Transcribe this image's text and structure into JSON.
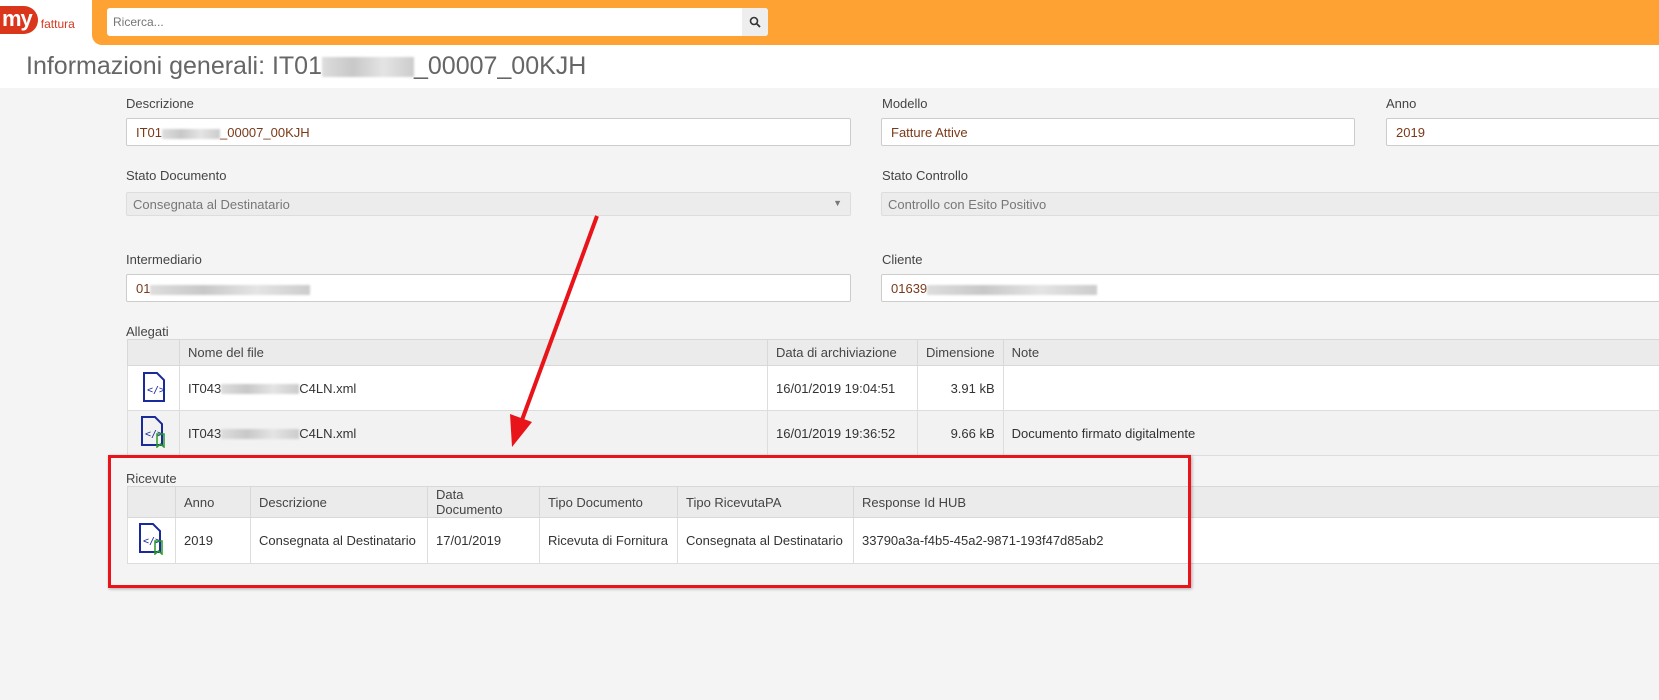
{
  "app": {
    "logo_main": "my",
    "logo_sub": "fattura"
  },
  "search": {
    "placeholder": "Ricerca..."
  },
  "page": {
    "title_prefix": "Informazioni generali: IT01",
    "title_suffix": "_00007_00KJH"
  },
  "form": {
    "descrizione": {
      "label": "Descrizione",
      "prefix": "IT01",
      "suffix": "_00007_00KJH"
    },
    "modello": {
      "label": "Modello",
      "value": "Fatture Attive"
    },
    "anno": {
      "label": "Anno",
      "value": "2019"
    },
    "stato_documento": {
      "label": "Stato Documento",
      "value": "Consegnata al Destinatario"
    },
    "stato_controllo": {
      "label": "Stato Controllo",
      "value": "Controllo con Esito Positivo"
    },
    "intermediario": {
      "label": "Intermediario",
      "prefix": "01"
    },
    "cliente": {
      "label": "Cliente",
      "prefix": "01639"
    }
  },
  "allegati": {
    "label": "Allegati",
    "columns": [
      "",
      "Nome del file",
      "Data di archiviazione",
      "Dimensione",
      "Note"
    ],
    "rows": [
      {
        "icon": "xml-file-icon",
        "name_prefix": "IT043",
        "name_suffix": "C4LN.xml",
        "date": "16/01/2019 19:04:51",
        "size": "3.91 kB",
        "note": ""
      },
      {
        "icon": "signed-xml-file-icon",
        "name_prefix": "IT043",
        "name_suffix": "C4LN.xml",
        "date": "16/01/2019 19:36:52",
        "size": "9.66 kB",
        "note": "Documento firmato digitalmente"
      }
    ]
  },
  "ricevute": {
    "label": "Ricevute",
    "columns": [
      "",
      "Anno",
      "Descrizione",
      "Data Documento",
      "Tipo Documento",
      "Tipo RicevutaPA",
      "Response Id HUB"
    ],
    "rows": [
      {
        "icon": "signed-xml-file-icon",
        "anno": "2019",
        "descrizione": "Consegnata al Destinatario",
        "data": "17/01/2019",
        "tipo_documento": "Ricevuta di Fornitura",
        "tipo_ricevuta": "Consegnata al Destinatario",
        "response_id": "33790a3a-f4b5-45a2-9871-193f47d85ab2"
      }
    ]
  },
  "colors": {
    "header": "#ffa234",
    "brand": "#d9361c",
    "annotation": "#e8141a"
  }
}
